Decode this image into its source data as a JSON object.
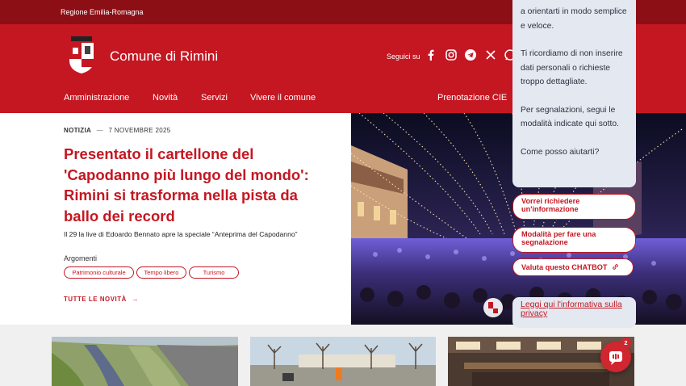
{
  "topbar": {
    "region": "Regione Emilia-Romagna"
  },
  "header": {
    "site_title": "Comune di Rimini",
    "follow_label": "Seguici su",
    "social_icons": [
      "facebook-icon",
      "instagram-icon",
      "telegram-icon",
      "x-icon",
      "whatsapp-icon"
    ],
    "nav": [
      "Amministrazione",
      "Novità",
      "Servizi",
      "Vivere il comune"
    ],
    "nav_right": "Prenotazione CIE"
  },
  "hero": {
    "category": "NOTIZIA",
    "separator": "—",
    "date": "7 NOVEMBRE 2025",
    "title": "Presentato il cartellone del 'Capodanno più lungo del mondo': Rimini si trasforma nella pista da ballo dei record",
    "subtitle": "Il 29 la live di Edoardo Bennato apre la speciale “Anteprima del Capodanno”",
    "topics_label": "Argomenti",
    "topics": [
      "Patrimonio culturale",
      "Tempo libero",
      "Turismo"
    ],
    "all_news": "TUTTE LE NOVITÀ",
    "all_news_arrow": "→"
  },
  "chat": {
    "messages": [
      "a orientarti in modo semplice e veloce.",
      "Ti ricordiamo di non inserire dati personali o richieste troppo dettagliate.",
      "Per segnalazioni, segui le modalità indicate qui sotto.",
      "Come posso aiutarti?"
    ],
    "options": [
      "Vorrei richiedere un'informazione",
      "Modalità per fare una segnalazione",
      "Valuta questo CHATBOT"
    ],
    "privacy_link": "Leggi qui l'informativa sulla privacy",
    "badge_count": "2"
  },
  "colors": {
    "brand_red": "#c41722",
    "dark_red": "#8c0f16",
    "chat_bg": "#e4e8f1"
  }
}
